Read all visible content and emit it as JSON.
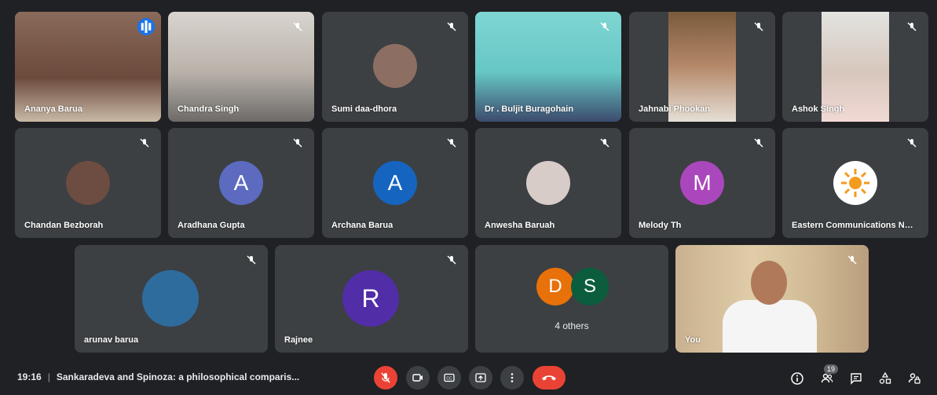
{
  "participants": [
    {
      "name": "Ananya Barua"
    },
    {
      "name": "Chandra Singh"
    },
    {
      "name": "Sumi daa-dhora"
    },
    {
      "name": "Dr . Buljit Buragohain"
    },
    {
      "name": "Jahnabi Phookan"
    },
    {
      "name": "Ashok Singh"
    },
    {
      "name": "Chandan Bezborah"
    },
    {
      "name": "Aradhana Gupta",
      "initial": "A"
    },
    {
      "name": "Archana Barua",
      "initial": "A"
    },
    {
      "name": "Anwesha Baruah"
    },
    {
      "name": "Melody Th",
      "initial": "M"
    },
    {
      "name": "Eastern Communications Net..."
    },
    {
      "name": "arunav barua"
    },
    {
      "name": "Rajnee",
      "initial": "R"
    },
    {
      "name": "4 others",
      "initials": [
        "D",
        "S"
      ]
    },
    {
      "name": "You"
    }
  ],
  "meeting": {
    "time": "19:16",
    "separator": "|",
    "title": "Sankaradeva and Spinoza: a philosophical comparis..."
  },
  "people_count": "19",
  "colors": {
    "accent": "#1a73e8",
    "hangup": "#ea4335",
    "aradhana": "#5c6bc0",
    "archana": "#1565c0",
    "melody": "#ab47bc",
    "rajnee": "#512da8",
    "d": "#e8710a",
    "s": "#0b5d3e"
  }
}
